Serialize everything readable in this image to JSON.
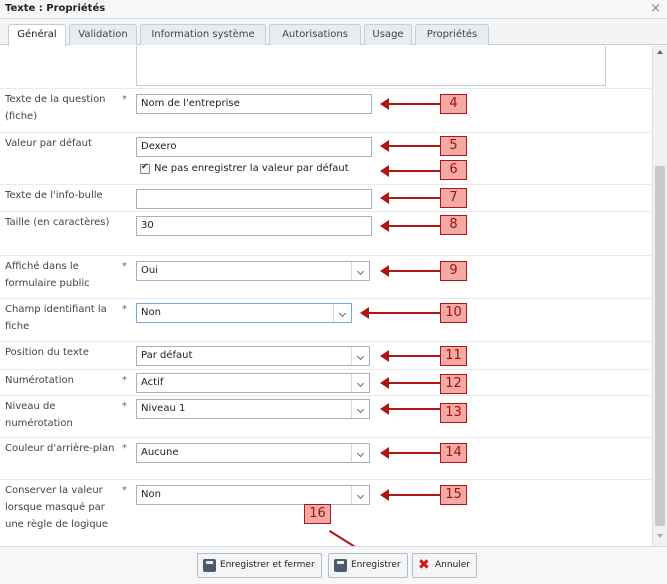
{
  "window": {
    "title": "Texte : Propriétés",
    "close_glyph": "×"
  },
  "tabs": [
    {
      "label": "Général",
      "active": true
    },
    {
      "label": "Validation"
    },
    {
      "label": "Information système"
    },
    {
      "label": "Autorisations"
    },
    {
      "label": "Usage"
    },
    {
      "label": "Propriétés"
    }
  ],
  "fields": {
    "question_text": {
      "label": "Texte de la question (fiche)",
      "required": "*",
      "value": "Nom de l'entreprise",
      "annotation": "4"
    },
    "default_value": {
      "label": "Valeur par défaut",
      "value": "Dexero",
      "annotation": "5"
    },
    "no_save_default": {
      "label": "Ne pas enregistrer la valeur par défaut",
      "checked": true,
      "annotation": "6"
    },
    "tooltip_text": {
      "label": "Texte de l'info-bulle",
      "value": "",
      "annotation": "7"
    },
    "size": {
      "label": "Taille (en caractères)",
      "value": "30",
      "annotation": "8"
    },
    "public_form": {
      "label": "Affiché dans le formulaire public",
      "required": "*",
      "value": "Oui",
      "annotation": "9"
    },
    "identifying_field": {
      "label": "Champ identifiant la fiche",
      "required": "*",
      "value": "Non",
      "annotation": "10"
    },
    "text_position": {
      "label": "Position du texte",
      "value": "Par défaut",
      "annotation": "11"
    },
    "numbering": {
      "label": "Numérotation",
      "required": "*",
      "value": "Actif",
      "annotation": "12"
    },
    "numbering_level": {
      "label": "Niveau de numérotation",
      "required": "*",
      "value": "Niveau 1",
      "annotation": "13"
    },
    "background_color": {
      "label": "Couleur d'arrière-plan",
      "required": "*",
      "value": "Aucune",
      "annotation": "14"
    },
    "keep_value_hidden": {
      "label": "Conserver la valeur lorsque masqué par une règle de logique",
      "required": "*",
      "value": "Non",
      "annotation": "15"
    }
  },
  "footer": {
    "save_close_label": "Enregistrer et fermer",
    "save_label": "Enregistrer",
    "cancel_label": "Annuler",
    "save_annotation": "16"
  },
  "colors": {
    "annotation_red": "#b01515",
    "annotation_fill": "#f3a9a4"
  },
  "icons": [
    "save-icon",
    "save-close-icon",
    "cancel-x-icon",
    "close-icon",
    "chevron-down-icon",
    "checkbox-checked-icon",
    "annotation-arrow-icon"
  ]
}
